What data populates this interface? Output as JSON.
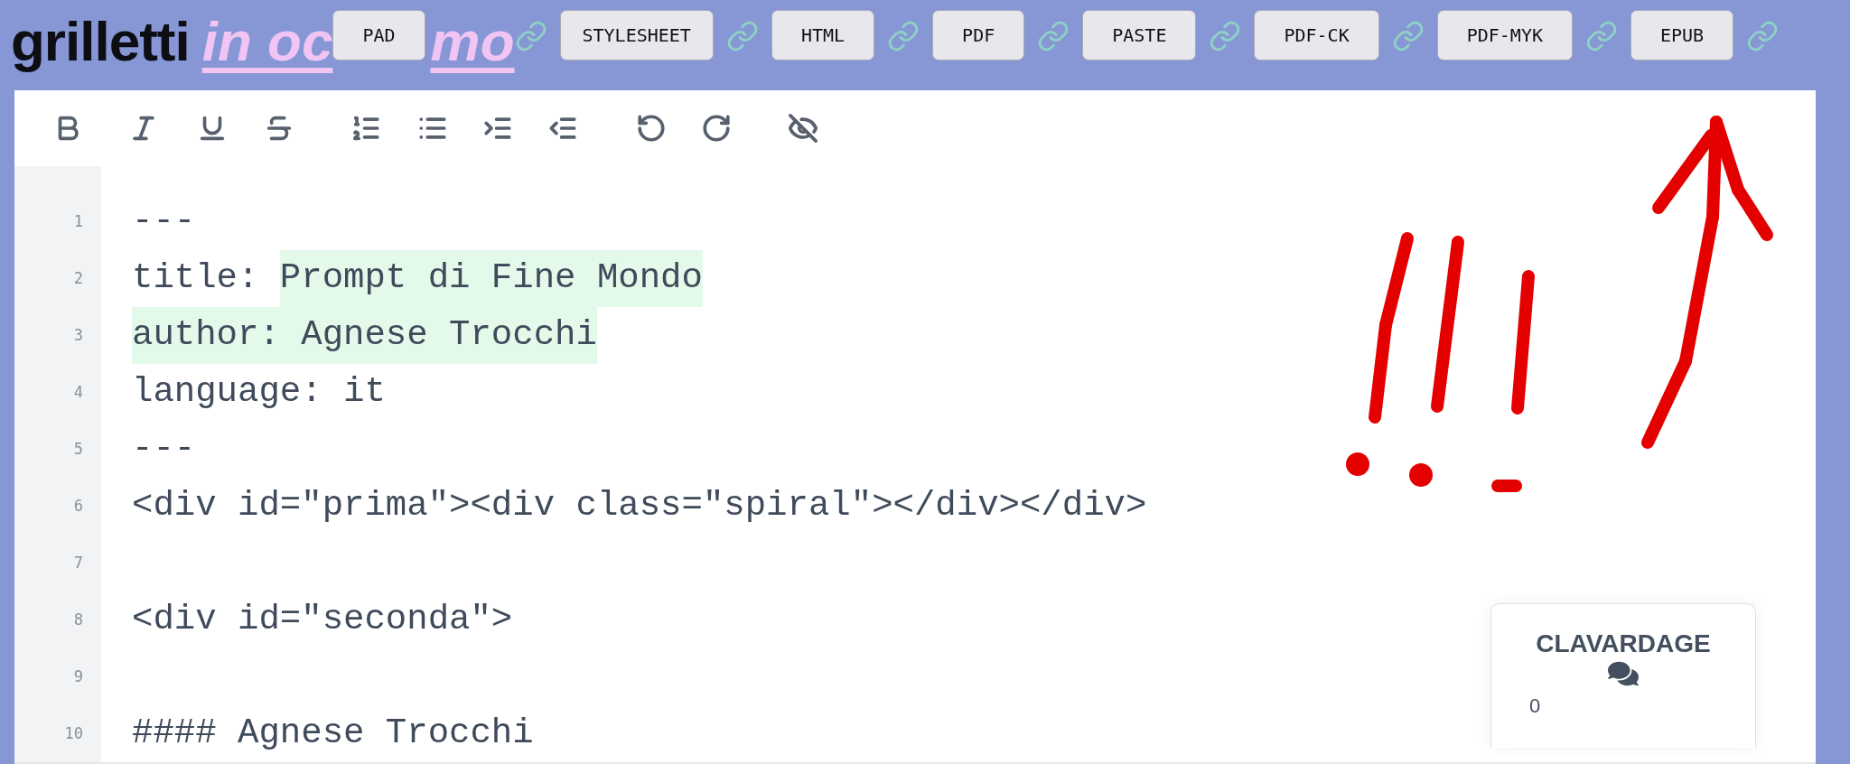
{
  "header": {
    "title": "grilletti",
    "link_start": "in oc",
    "link_end": "mo",
    "buttons": [
      {
        "label": "PAD"
      },
      {
        "label": "STYLESHEET"
      },
      {
        "label": "HTML"
      },
      {
        "label": "PDF"
      },
      {
        "label": "PASTE"
      },
      {
        "label": "PDF-CK"
      },
      {
        "label": "PDF-MYK"
      },
      {
        "label": "EPUB"
      }
    ]
  },
  "editor": {
    "lines": [
      {
        "number": "1",
        "segments": [
          {
            "text": "---",
            "highlighted": false
          }
        ]
      },
      {
        "number": "2",
        "segments": [
          {
            "text": "title: ",
            "highlighted": false
          },
          {
            "text": "Prompt di Fine Mondo",
            "highlighted": true
          }
        ]
      },
      {
        "number": "3",
        "segments": [
          {
            "text": "author: Agnese Trocchi",
            "highlighted": true
          }
        ]
      },
      {
        "number": "4",
        "segments": [
          {
            "text": "language: it",
            "highlighted": false
          }
        ]
      },
      {
        "number": "5",
        "segments": [
          {
            "text": "---",
            "highlighted": false
          }
        ]
      },
      {
        "number": "6",
        "segments": [
          {
            "text": "<div id=\"prima\"><div class=\"spiral\"></div></div>",
            "highlighted": false
          }
        ]
      },
      {
        "number": "7"
      },
      {
        "number": "8",
        "segments": [
          {
            "text": "<div id=\"seconda\">",
            "highlighted": false
          }
        ]
      },
      {
        "number": "9"
      },
      {
        "number": "10",
        "segments": [
          {
            "text": "#### Agnese Trocchi",
            "highlighted": false
          }
        ]
      }
    ]
  },
  "chat": {
    "title": "CLAVARDAGE",
    "count": "0"
  }
}
